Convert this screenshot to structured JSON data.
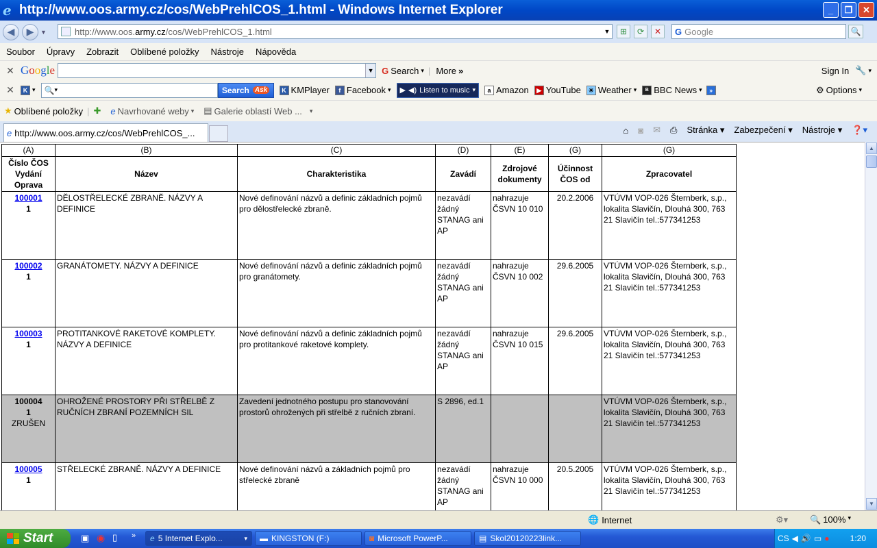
{
  "window": {
    "title": "http://www.oos.army.cz/cos/WebPrehlCOS_1.html - Windows Internet Explorer"
  },
  "address": {
    "url_prefix": "http://www.oos.",
    "url_domain": "army.cz",
    "url_rest": "/cos/WebPrehlCOS_1.html",
    "search_placeholder": "Google"
  },
  "menu": [
    "Soubor",
    "Úpravy",
    "Zobrazit",
    "Oblíbené položky",
    "Nástroje",
    "Nápověda"
  ],
  "google_bar": {
    "search_label": "Search",
    "more_label": "More",
    "signin_label": "Sign In"
  },
  "ask_bar": {
    "search_label": "Search",
    "items": [
      "KMPlayer",
      "Facebook",
      "Listen to music",
      "Amazon",
      "YouTube",
      "Weather",
      "BBC News"
    ],
    "options_label": "Options"
  },
  "favorites": {
    "label": "Oblíbené položky",
    "suggested": "Navrhované weby",
    "gallery": "Galerie oblastí Web ..."
  },
  "tab": {
    "title": "http://www.oos.army.cz/cos/WebPrehlCOS_..."
  },
  "commands": {
    "page": "Stránka",
    "security": "Zabezpečení",
    "tools": "Nástroje"
  },
  "table": {
    "letters": [
      "(A)",
      "(B)",
      "(C)",
      "(D)",
      "(E)",
      "(G)",
      "(G)"
    ],
    "headers": [
      "Číslo ČOS Vydání Oprava",
      "Název",
      "Charakteristika",
      "Zavádí",
      "Zdrojové dokumenty",
      "Účinnost ČOS od",
      "Zpracovatel"
    ],
    "rows": [
      {
        "id": "100001",
        "edition": "1",
        "status": "",
        "name": "DĚLOSTŘELECKÉ ZBRANĚ. NÁZVY A DEFINICE",
        "desc": "Nové definování názvů a definic základních pojmů pro dělostřelecké zbraně.",
        "introduces": "nezavádí žádný STANAG ani AP",
        "source": "nahrazuje ČSVN 10 010",
        "date": "20.2.2006",
        "processor": "VTÚVM VOP-026 Šternberk, s.p., lokalita Slavičín, Dlouhá 300, 763 21 Slavičín tel.:577341253"
      },
      {
        "id": "100002",
        "edition": "1",
        "status": "",
        "name": "GRANÁTOMETY. NÁZVY A DEFINICE",
        "desc": "Nové definování názvů a definic základních pojmů pro granátomety.",
        "introduces": "nezavádí žádný STANAG ani AP",
        "source": "nahrazuje ČSVN 10 002",
        "date": "29.6.2005",
        "processor": "VTÚVM VOP-026 Šternberk, s.p., lokalita Slavičín, Dlouhá 300, 763 21 Slavičín tel.:577341253"
      },
      {
        "id": "100003",
        "edition": "1",
        "status": "",
        "name": "PROTITANKOVÉ RAKETOVÉ KOMPLETY. NÁZVY A DEFINICE",
        "desc": "Nové definování názvů a definic základních pojmů pro protitankové raketové komplety.",
        "introduces": "nezavádí žádný STANAG ani AP",
        "source": "nahrazuje ČSVN 10 015",
        "date": "29.6.2005",
        "processor": "VTÚVM VOP-026 Šternberk, s.p., lokalita Slavičín, Dlouhá 300, 763 21 Slavičín tel.:577341253"
      },
      {
        "id": "100004",
        "edition": "1",
        "status": "ZRUŠEN",
        "name": "OHROŽENÉ PROSTORY PŘI STŘELBĚ Z RUČNÍCH ZBRANÍ POZEMNÍCH SIL",
        "desc": "Zavedení jednotného postupu pro stanovování prostorů ohrožených při střelbě z ručních zbraní.",
        "introduces": "S 2896, ed.1",
        "source": "",
        "date": "",
        "processor": "VTÚVM VOP-026 Šternberk, s.p., lokalita Slavičín, Dlouhá 300, 763 21 Slavičín tel.:577341253"
      },
      {
        "id": "100005",
        "edition": "1",
        "status": "",
        "name": "STŘELECKÉ ZBRANĚ. NÁZVY A DEFINICE",
        "desc": "Nové definování názvů a základních pojmů pro střelecké zbraně",
        "introduces": "nezavádí žádný STANAG ani AP",
        "source": "nahrazuje ČSVN 10 000",
        "date": "20.5.2005",
        "processor": "VTÚVM VOP-026 Šternberk, s.p., lokalita Slavičín, Dlouhá 300, 763 21 Slavičín tel.:577341253"
      }
    ]
  },
  "status": {
    "zone": "Internet",
    "zoom": "100%"
  },
  "taskbar": {
    "start": "Start",
    "buttons": [
      "5 Internet Explo...",
      "KINGSTON (F:)",
      "Microsoft PowerP...",
      "Skol20120223link..."
    ],
    "lang": "CS",
    "clock": "1:20"
  }
}
